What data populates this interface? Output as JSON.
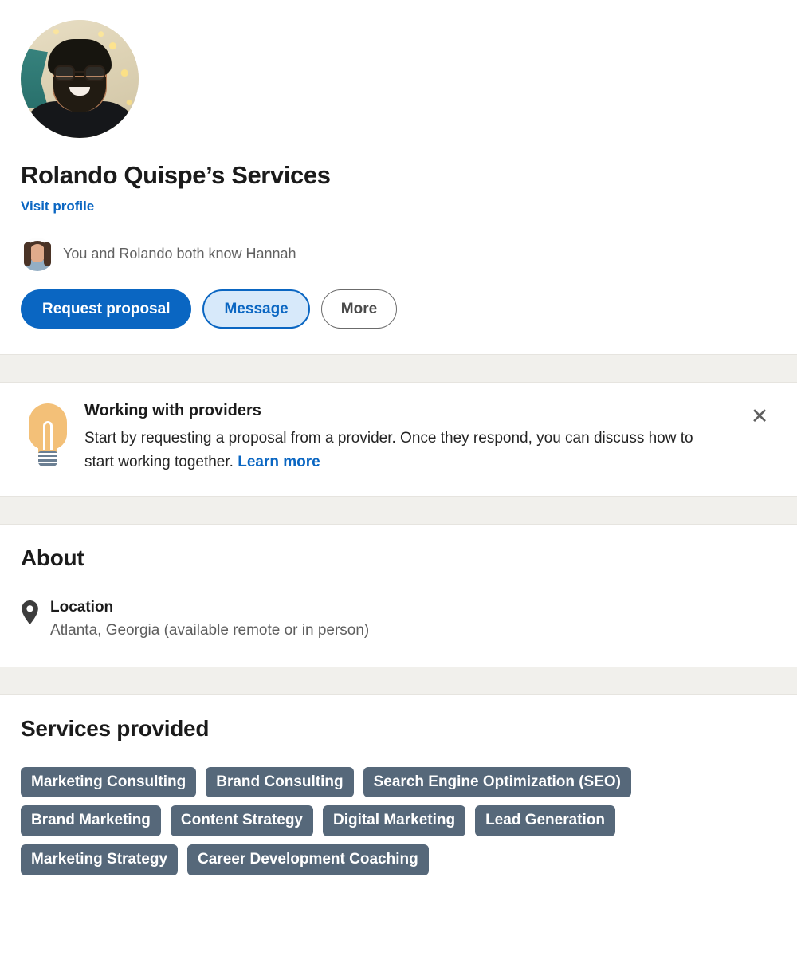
{
  "profile": {
    "avatar_alt": "profile-photo-rolando-quispe",
    "name": "Rolando Quispe’s Services",
    "visit_profile_label": "Visit profile"
  },
  "mutual": {
    "avatar_alt": "mutual-connection-photo-hannah",
    "text": "You and Rolando both know Hannah"
  },
  "actions": {
    "primary_label": "Request proposal",
    "secondary_label": "Message",
    "tertiary_label": "More"
  },
  "tip": {
    "icon": "lightbulb-icon",
    "title": "Working with providers",
    "description": "Start by requesting a proposal from a provider. Once they respond, you can discuss how to start working together.",
    "link_label": "Learn more",
    "close_label": "✕"
  },
  "about": {
    "heading": "About",
    "location_icon": "location-pin-icon",
    "location_label": "Location",
    "location_value": "Atlanta, Georgia (available remote or in person)"
  },
  "services": {
    "heading": "Services provided",
    "tags": [
      "Marketing Consulting",
      "Brand Consulting",
      "Search Engine Optimization (SEO)",
      "Brand Marketing",
      "Content Strategy",
      "Digital Marketing",
      "Lead Generation",
      "Marketing Strategy",
      "Career Development Coaching"
    ]
  },
  "colors": {
    "brand_blue": "#0a66c2",
    "secondary_fill": "#d7e9fa",
    "tag_bg": "#56687a",
    "divider_bg": "#f1f0ec",
    "bulb_orange": "#f3c078",
    "bulb_base": "#6b7f93",
    "text_primary": "#1b1b1b",
    "text_muted": "#5e5e5e"
  }
}
